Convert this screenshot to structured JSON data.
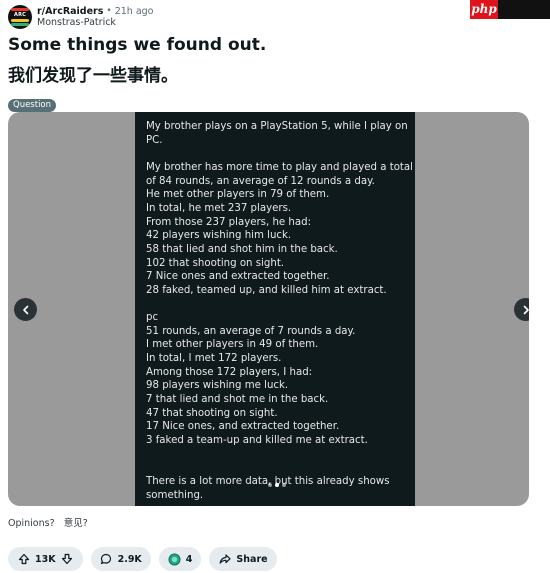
{
  "post": {
    "subreddit": "r/ArcRaiders",
    "separator": "•",
    "time_ago": "21h ago",
    "author": "Monstras-Patrick",
    "avatar_text": "ARC",
    "title_en": "Some things we found out.",
    "title_zh": "我们发现了一些事情。",
    "flair": "Question",
    "caption": "Opinions?   意见?"
  },
  "watermark": {
    "text": "php"
  },
  "gallery": {
    "lines": [
      "My brother plays on a PlayStation 5, while I play on",
      "PC.",
      "",
      "My brother has more time to play and played a total",
      "of 84 rounds, an average of 12 rounds a day.",
      "He met other players in 79 of them.",
      "In total, he met 237 players.",
      "From those 237 players, he had:",
      "42 players wishing him luck.",
      "58 that lied and shot him in the back.",
      "102 that shooting on sight.",
      "7 Nice ones and extracted together.",
      "28 faked, teamed up, and killed him at extract.",
      "",
      "pc",
      "51 rounds, an average of 7 rounds a day.",
      "I met other players in 49 of them.",
      "In total, I met 172 players.",
      "Among those 172 players, I had:",
      "98 players wishing me luck.",
      "7 that lied and shot me in the back.",
      "47 that shooting on sight.",
      "17 Nice ones, and extracted together.",
      "3 faked a team-up and killed me at extract.",
      "",
      "",
      "There is a lot more data, but this already shows",
      "something."
    ]
  },
  "actions": {
    "votes": "13K",
    "comments": "2.9K",
    "awards": "4",
    "share": "Share"
  },
  "colors": {
    "accent_award": "#23a98a",
    "pill_bg": "#e5ebee",
    "flair_bg": "#576f76",
    "watermark_red": "#e0121b"
  },
  "icons": {
    "upvote": "arrow-up-icon",
    "downvote": "arrow-down-icon",
    "comment": "comment-bubble-icon",
    "award": "award-icon",
    "share": "share-arrow-icon",
    "prev": "chevron-left-icon",
    "next": "chevron-right-icon"
  }
}
